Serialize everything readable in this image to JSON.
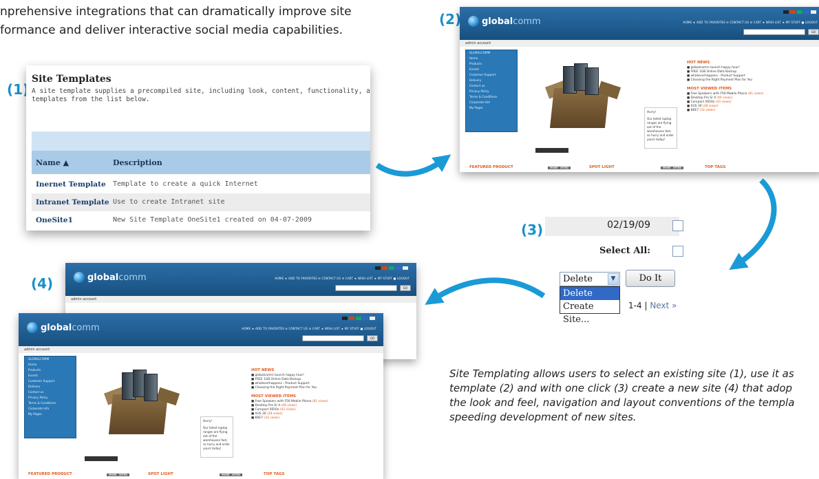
{
  "intro": {
    "line1": "nprehensive integrations that can dramatically improve site",
    "line2": "formance and deliver interactive social media capabilities."
  },
  "labels": {
    "step1": "(1)",
    "step2": "(2)",
    "step3": "(3)",
    "step4": "(4)"
  },
  "site_templates": {
    "title": "Site Templates",
    "desc_line1": "A site template supplies a precompiled site, including look, content, functionality, and navi",
    "desc_line2": "templates from the list below.",
    "col_name": "Name ▲",
    "col_desc": "Description",
    "rows": [
      {
        "name": "Inernet Template",
        "desc": "Template to create a quick Internet"
      },
      {
        "name": "Intranet Template",
        "desc": "Use to create Intranet site"
      },
      {
        "name": "OneSite1",
        "desc": "New Site Template OneSite1 created on 04-07-2009"
      }
    ]
  },
  "site": {
    "logo_bold": "global",
    "logo_light": "comm",
    "topnav": "HOME  ★ ADD TO FAVORITES  ✉ CONTACT US  ☰ CART  ★ WISH LIST  ★ MY STUFF  ■ LOGOUT",
    "search_btn": "GO",
    "account": "admin account",
    "nav": [
      "GLOBALCOMM",
      "Home",
      "Products",
      "Events",
      "Customer Support",
      "Delivery",
      "Contact us",
      "Privacy Policy",
      "Terms & Conditions",
      "Corporate Info",
      "My Pages"
    ],
    "hurry_title": "Hurry!",
    "hurry_body": "Our latest laptop ranges are flying out of the warehouses fast, so hurry and order yours today!",
    "hot_news_title": "HOT NEWS",
    "hot_news": [
      "globalcomm launch happy hour!",
      "FREE 1GB Online Data Backup",
      "whateverhappens - Product Support",
      "Choosing the Right Payment Plan for You"
    ],
    "most_viewed_title": "MOST VIEWED ITEMS",
    "most_viewed": [
      {
        "name": "Free Speakers with F56 Mobile Phone",
        "views": "(81 views)"
      },
      {
        "name": "Desktop Pro Sr II",
        "views": "(49 views)"
      },
      {
        "name": "Compact 5650x",
        "views": "(43 views)"
      },
      {
        "name": "XUS 30",
        "views": "(38 views)"
      },
      {
        "name": "KBE7",
        "views": "(33 views)"
      }
    ],
    "featured": "FEATURED PRODUCT",
    "spotlight": "SPOT LIGHT",
    "top_tags": "TOP TAGS",
    "pill_highlighted": "HIGHLIGHTED",
    "pill_more": "MORE"
  },
  "actions": {
    "date": "02/19/09",
    "select_all": "Select All:",
    "selected": "Delete",
    "do_it": "Do It",
    "options": [
      "Delete",
      "Create Site..."
    ],
    "pager_range": "1-4",
    "pager_sep": "|",
    "pager_next": "Next »"
  },
  "caption": {
    "line1": "Site Templating allows users to select an existing site (1), use it as",
    "line2": "template (2) and with one click (3) create a new site (4) that adop",
    "line3": "the look and feel, navigation and layout conventions of the templa",
    "line4": "speeding development of new sites."
  },
  "colors": {
    "accent": "#1a8fc9",
    "header_blue": "#1f5f94",
    "orange": "#e0581c"
  }
}
